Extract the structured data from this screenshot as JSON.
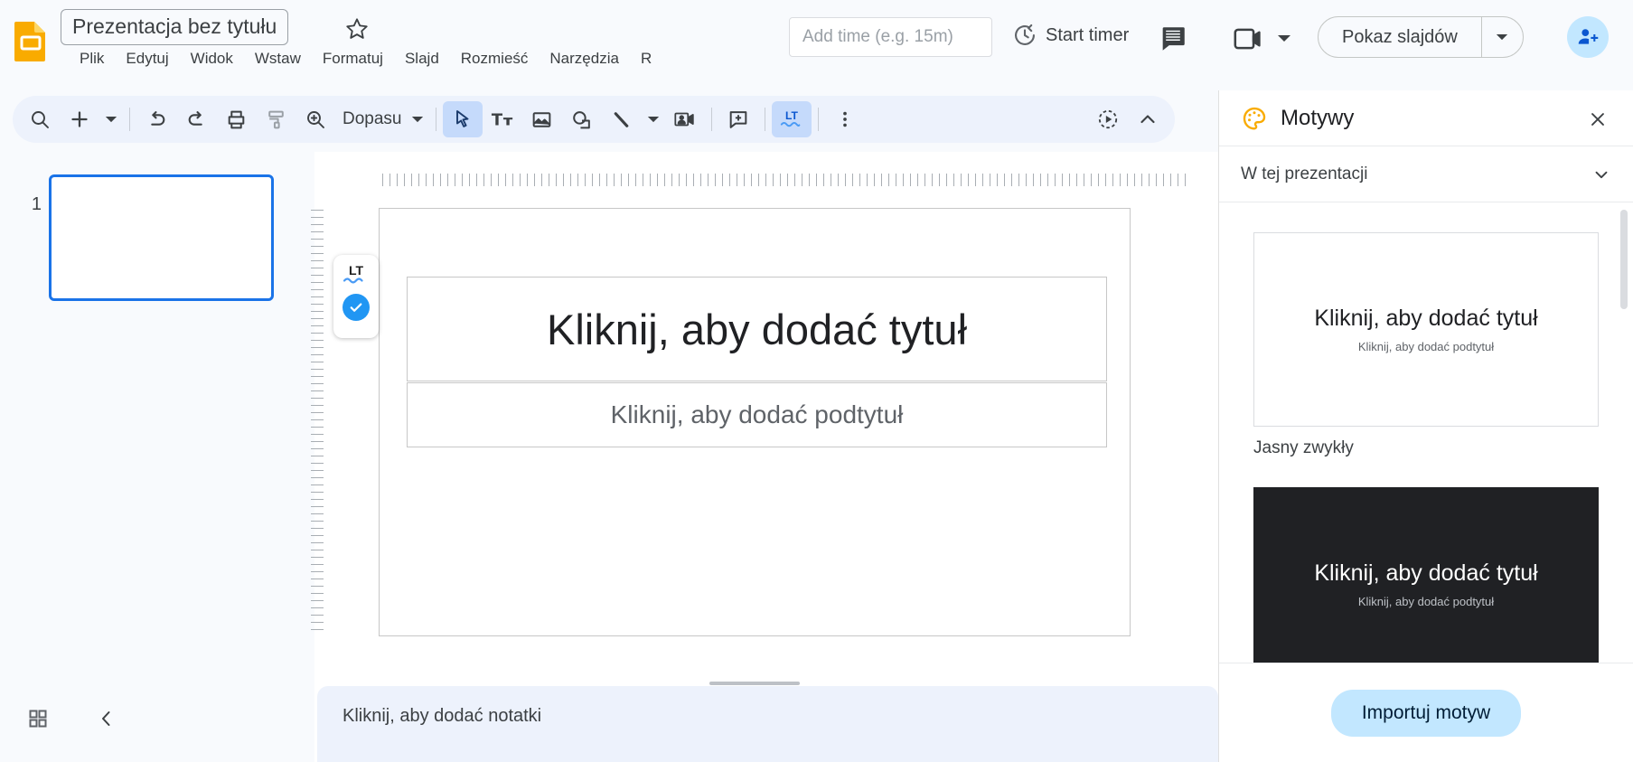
{
  "app": {
    "product": "Google Slides",
    "logo_icon": "slides-logo-icon"
  },
  "header": {
    "document_title": "Prezentacja bez tytułu",
    "star_icon": "star-outline-icon",
    "menus": [
      "Plik",
      "Edytuj",
      "Widok",
      "Wstaw",
      "Formatuj",
      "Slajd",
      "Rozmieść",
      "Narzędzia",
      "R"
    ],
    "timer": {
      "placeholder": "Add time (e.g. 15m)",
      "value": "",
      "start_label": "Start timer",
      "timer_icon": "timer-icon"
    },
    "comment_icon": "comment-icon",
    "video_icon": "video-camera-icon",
    "video_caret_icon": "caret-down-icon",
    "present_label": "Pokaz slajdów",
    "present_caret_icon": "caret-down-icon",
    "share_icon": "person-add-icon"
  },
  "toolbar": {
    "items": [
      {
        "name": "search-icon",
        "label": "Szukaj"
      },
      {
        "name": "new-slide-icon",
        "label": "Nowy slajd"
      },
      {
        "name": "undo-icon",
        "label": "Cofnij"
      },
      {
        "name": "redo-icon",
        "label": "Ponów"
      },
      {
        "name": "print-icon",
        "label": "Drukuj"
      },
      {
        "name": "paint-format-icon",
        "label": "Kopiuj formatowanie"
      },
      {
        "name": "zoom-icon",
        "label": "Powiększenie"
      },
      {
        "name": "select-cursor-icon",
        "label": "Zaznacz"
      },
      {
        "name": "text-box-icon",
        "label": "Pole tekstowe"
      },
      {
        "name": "image-icon",
        "label": "Obraz"
      },
      {
        "name": "shape-icon",
        "label": "Kształt"
      },
      {
        "name": "line-icon",
        "label": "Linia"
      },
      {
        "name": "insert-video-icon",
        "label": "Wideo"
      },
      {
        "name": "add-comment-icon",
        "label": "Dodaj komentarz"
      },
      {
        "name": "languagetool-icon",
        "label": "LanguageTool"
      },
      {
        "name": "more-options-icon",
        "label": "Więcej"
      },
      {
        "name": "transition-icon",
        "label": "Przejście"
      },
      {
        "name": "collapse-toolbar-icon",
        "label": "Zwiń"
      }
    ],
    "zoom_label": "Dopasu",
    "zoom_full_label": "Dopasuj"
  },
  "filmstrip": {
    "slides": [
      {
        "number": "1",
        "selected": true
      }
    ],
    "grid_view_icon": "grid-view-icon",
    "collapse_icon": "chevron-left-icon"
  },
  "canvas": {
    "title_placeholder": "Kliknij, aby dodać tytuł",
    "subtitle_placeholder": "Kliknij, aby dodać podtytuł",
    "lt_widget": {
      "logo_text": "LT",
      "status_icon": "check-circle-icon"
    }
  },
  "notes": {
    "placeholder": "Kliknij, aby dodać notatki"
  },
  "themes_panel": {
    "title": "Motywy",
    "palette_icon": "palette-icon",
    "close_icon": "close-icon",
    "section_label": "W tej prezentacji",
    "section_caret_icon": "chevron-down-icon",
    "themes": [
      {
        "name": "Jasny zwykły",
        "title_text": "Kliknij, aby dodać tytuł",
        "subtitle_text": "Kliknij, aby dodać podtytuł",
        "dark": false
      },
      {
        "name": "",
        "title_text": "Kliknij, aby dodać tytuł",
        "subtitle_text": "Kliknij, aby dodać podtytuł",
        "dark": true
      }
    ],
    "import_label": "Importuj motyw"
  },
  "colors": {
    "accent_blue": "#1a73e8",
    "toolbar_bg": "#edf2fc",
    "active_tool_bg": "#c5dafb",
    "share_bg": "#c2e7ff",
    "logo_yellow": "#f9ab00",
    "lt_blue": "#2196f3",
    "dark_theme_bg": "#202124"
  }
}
